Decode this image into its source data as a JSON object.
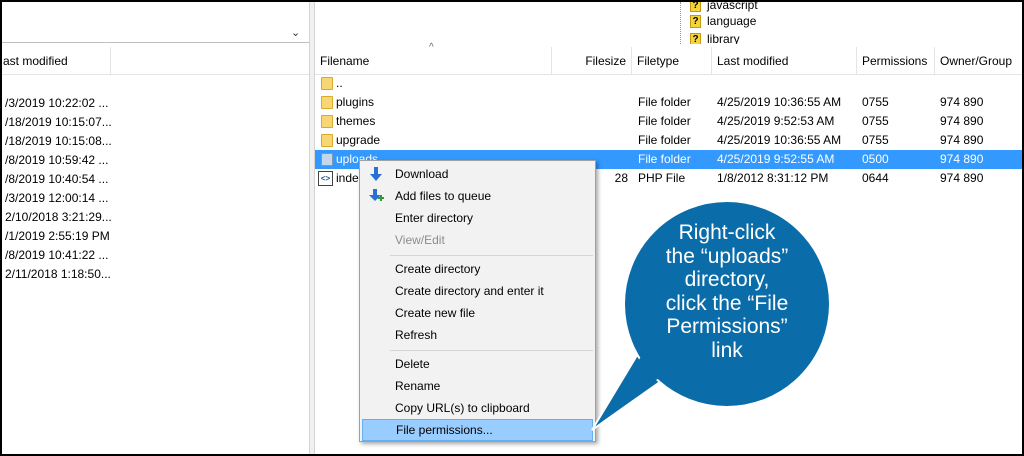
{
  "tree": {
    "items": [
      {
        "label": "javascript"
      },
      {
        "label": "language"
      },
      {
        "label": "library"
      }
    ]
  },
  "left_pane": {
    "header": "ast modified",
    "rows": [
      "/3/2019 10:22:02 ...",
      "/18/2019 10:15:07...",
      "/18/2019 10:15:08...",
      "/8/2019 10:59:42 ...",
      "/8/2019 10:40:54 ...",
      "/3/2019 12:00:14 ...",
      "2/10/2018 3:21:29...",
      "/1/2019 2:55:19 PM",
      "/8/2019 10:41:22 ...",
      "2/11/2018 1:18:50..."
    ]
  },
  "right_pane": {
    "columns": {
      "filename": "Filename",
      "filesize": "Filesize",
      "filetype": "Filetype",
      "last_modified": "Last modified",
      "permissions": "Permissions",
      "owner_group": "Owner/Group"
    },
    "rows": [
      {
        "name": "..",
        "size": "",
        "type": "",
        "modified": "",
        "perms": "",
        "owner": ""
      },
      {
        "name": "plugins",
        "size": "",
        "type": "File folder",
        "modified": "4/25/2019 10:36:55 AM",
        "perms": "0755",
        "owner": "974 890"
      },
      {
        "name": "themes",
        "size": "",
        "type": "File folder",
        "modified": "4/25/2019 9:52:53 AM",
        "perms": "0755",
        "owner": "974 890"
      },
      {
        "name": "upgrade",
        "size": "",
        "type": "File folder",
        "modified": "4/25/2019 10:36:55 AM",
        "perms": "0755",
        "owner": "974 890"
      },
      {
        "name": "uploads",
        "size": "",
        "type": "File folder",
        "modified": "4/25/2019 9:52:55 AM",
        "perms": "0500",
        "owner": "974 890"
      },
      {
        "name": "inde",
        "size": "28",
        "type": "PHP File",
        "modified": "1/8/2012 8:31:12 PM",
        "perms": "0644",
        "owner": "974 890"
      }
    ]
  },
  "context_menu": {
    "download": "Download",
    "add_to_queue": "Add files to queue",
    "enter_directory": "Enter directory",
    "view_edit": "View/Edit",
    "create_directory": "Create directory",
    "create_directory_enter": "Create directory and enter it",
    "create_new_file": "Create new file",
    "refresh": "Refresh",
    "delete": "Delete",
    "rename": "Rename",
    "copy_url": "Copy URL(s) to clipboard",
    "file_permissions": "File permissions..."
  },
  "callout": {
    "text_line1": "Right-click",
    "text_line2": "the “uploads”",
    "text_line3": "directory,",
    "text_line4": "click the “File",
    "text_line5": "Permissions”",
    "text_line6": "link",
    "color": "#0a6ca8"
  },
  "colors": {
    "selection": "#3399ff",
    "menu_highlight": "#99ccff",
    "folder": "#f7d774"
  }
}
